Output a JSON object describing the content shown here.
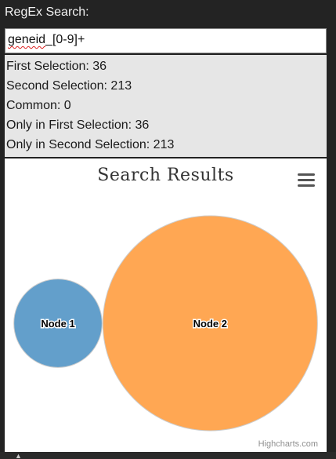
{
  "panel": {
    "title": "RegEx Search:"
  },
  "search": {
    "value_word": "geneid",
    "value_rest": "_[0-9]+"
  },
  "stats": {
    "first_selection": "First Selection: 36",
    "second_selection": "Second Selection: 213",
    "common": "Common: 0",
    "only_first": "Only in First Selection: 36",
    "only_second": "Only in Second Selection: 213"
  },
  "chart": {
    "credits": "Highcharts.com",
    "menu_icon": "hamburger-menu-icon"
  },
  "chart_data": {
    "type": "venn",
    "title": "Search Results",
    "sets": [
      {
        "name": "Node 1",
        "value": 36,
        "color": "#5b9ac8"
      },
      {
        "name": "Node 2",
        "value": 213,
        "color": "#ffa24a"
      }
    ],
    "intersection": 0
  }
}
